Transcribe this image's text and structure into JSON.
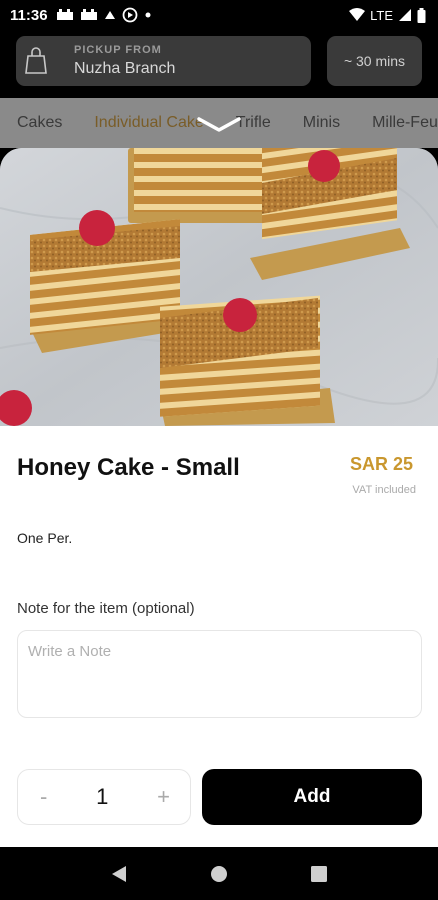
{
  "status_bar": {
    "time": "11:36",
    "network": "LTE"
  },
  "header": {
    "pickup_label": "PICKUP FROM",
    "branch": "Nuzha Branch",
    "eta": "~ 30 mins"
  },
  "tabs": [
    {
      "label": "Cakes"
    },
    {
      "label": "Individual Cake"
    },
    {
      "label": "Trifle"
    },
    {
      "label": "Minis"
    },
    {
      "label": "Mille-Feu"
    }
  ],
  "product": {
    "title": "Honey Cake - Small",
    "price": "SAR 25",
    "vat_note": "VAT included",
    "description": "One Per."
  },
  "note": {
    "label": "Note for the item (optional)",
    "placeholder": "Write a Note"
  },
  "stepper": {
    "minus": "-",
    "quantity": "1",
    "plus": "+"
  },
  "actions": {
    "add_label": "Add"
  },
  "colors": {
    "accent_price": "#c9972e",
    "active_tab": "#7a5d28",
    "button_bg": "#000000"
  }
}
